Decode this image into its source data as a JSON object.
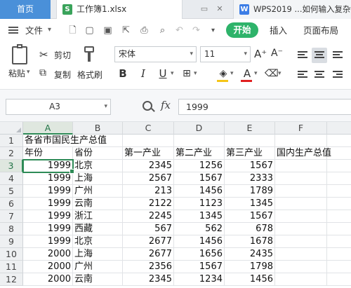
{
  "tabbar": {
    "home_label": "首页",
    "file_tab_label": "工作簿1.xlsx",
    "file_icon_letter": "S",
    "other_tab_label": "WPS2019 ...如何输入复杂",
    "other_icon_letter": "W"
  },
  "menubar": {
    "file_label": "文件",
    "start_label": "开始",
    "items": [
      "插入",
      "页面布局"
    ]
  },
  "ribbon": {
    "paste_label": "粘贴",
    "cut_label": "剪切",
    "copy_label": "复制",
    "format_painter_label": "格式刷",
    "font_name": "宋体",
    "font_size": "11",
    "bold": "B",
    "italic": "I",
    "underline": "U",
    "font_color_letter": "A",
    "grow_font": "A⁺",
    "shrink_font": "A⁻"
  },
  "formula_bar": {
    "cell_ref": "A3",
    "fx_label": "fx",
    "value": "1999"
  },
  "grid": {
    "columns": [
      "A",
      "B",
      "C",
      "D",
      "E",
      "F"
    ],
    "selected_column": "A",
    "selected_row": "3",
    "row_numbers": [
      "1",
      "2",
      "3",
      "4",
      "5",
      "6",
      "7",
      "8",
      "9",
      "10",
      "11",
      "12"
    ],
    "title": "各省市国民生产总值",
    "headers": [
      "年份",
      "省份",
      "第一产业",
      "第二产业",
      "第三产业",
      "国内生产总值"
    ],
    "rows": [
      [
        "1999",
        "北京",
        "2345",
        "1256",
        "1567"
      ],
      [
        "1999",
        "上海",
        "2567",
        "1567",
        "2333"
      ],
      [
        "1999",
        "广州",
        "213",
        "1456",
        "1789"
      ],
      [
        "1999",
        "云南",
        "2122",
        "1123",
        "1345"
      ],
      [
        "1999",
        "浙江",
        "2245",
        "1345",
        "1567"
      ],
      [
        "1999",
        "西藏",
        "567",
        "562",
        "678"
      ],
      [
        "1999",
        "北京",
        "2677",
        "1456",
        "1678"
      ],
      [
        "2000",
        "上海",
        "2677",
        "1656",
        "2435"
      ],
      [
        "2000",
        "广州",
        "2356",
        "1567",
        "1798"
      ],
      [
        "2000",
        "云南",
        "2345",
        "1234",
        "1456"
      ]
    ]
  },
  "colors": {
    "accent_green": "#2eb36a",
    "selection_green": "#2e8b57",
    "home_tab_blue": "#4a90d9"
  }
}
